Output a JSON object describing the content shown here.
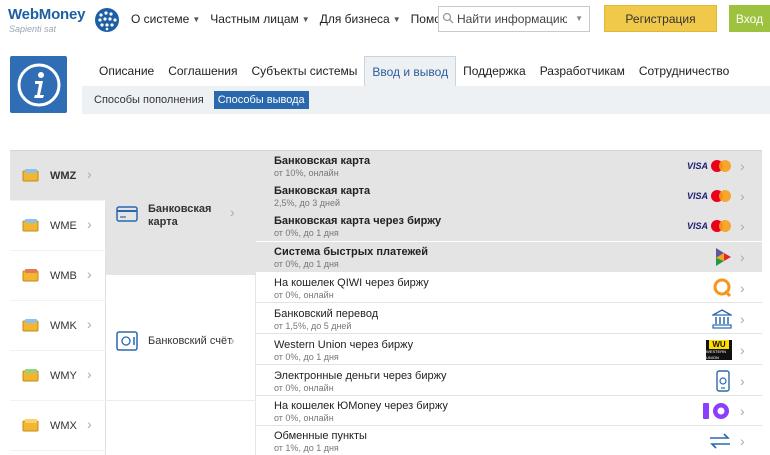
{
  "header": {
    "logo_text": "WebMoney",
    "logo_sub": "Sapienti sat",
    "nav": [
      {
        "label": "О системе"
      },
      {
        "label": "Частным лицам"
      },
      {
        "label": "Для бизнеса"
      },
      {
        "label": "Помощь"
      }
    ],
    "search_placeholder": "Найти информацию",
    "register_label": "Регистрация",
    "login_label": "Вход"
  },
  "tabs": [
    {
      "label": "Описание"
    },
    {
      "label": "Соглашения"
    },
    {
      "label": "Субъекты системы"
    },
    {
      "label": "Ввод и вывод"
    },
    {
      "label": "Поддержка"
    },
    {
      "label": "Разработчикам"
    },
    {
      "label": "Сотрудничество"
    }
  ],
  "active_tab": "Ввод и вывод",
  "subtabs": [
    {
      "label": "Способы пополнения"
    },
    {
      "label": "Способы вывода"
    }
  ],
  "active_subtab": "Способы вывода",
  "currencies": [
    {
      "label": "WMZ",
      "color": "#f2b632"
    },
    {
      "label": "WME",
      "color": "#f2b632"
    },
    {
      "label": "WMB",
      "color": "#f2b632"
    },
    {
      "label": "WMK",
      "color": "#f2b632"
    },
    {
      "label": "WMY",
      "color": "#f2b632"
    },
    {
      "label": "WMX",
      "color": "#f2b632"
    }
  ],
  "active_currency": "WMZ",
  "methods": [
    {
      "label": "Банковская карта"
    },
    {
      "label": "Банковский счёт"
    }
  ],
  "active_method": "Банковская карта",
  "options": [
    {
      "name": "Банковская карта",
      "meta": "от 10%, онлайн",
      "logo": "visa-mastercard-icon"
    },
    {
      "name": "Банковская карта",
      "meta": "2,5%, до 3 дней",
      "logo": "visa-mastercard-icon"
    },
    {
      "name": "Банковская карта через биржу",
      "meta": "от 0%, до 1 дня",
      "logo": "visa-mastercard-icon"
    },
    {
      "name": "Система быстрых платежей",
      "meta": "от 0%, до 1 дня",
      "logo": "sbp-icon"
    },
    {
      "name": "На кошелек QIWI через биржу",
      "meta": "от 0%, онлайн",
      "logo": "qiwi-icon"
    },
    {
      "name": "Банковский перевод",
      "meta": "от 1,5%, до 5 дней",
      "logo": "bank-icon"
    },
    {
      "name": "Western Union через биржу",
      "meta": "от 0%, до 1 дня",
      "logo": "western-union-icon"
    },
    {
      "name": "Электронные деньги через биржу",
      "meta": "от 0%, онлайн",
      "logo": "e-money-icon"
    },
    {
      "name": "На кошелек ЮMoney через биржу",
      "meta": "от 0%, онлайн",
      "logo": "yoomoney-icon"
    },
    {
      "name": "Обменные пункты",
      "meta": "от 1%, до 1 дня",
      "logo": "exchange-icon"
    }
  ],
  "visa_text": "VISA",
  "wu_text": "WESTERN UNION",
  "wu_mark": "WU",
  "colors": {
    "accent": "#2a68ae",
    "register": "#f0c94a",
    "login": "#9cc23f",
    "highlight": "#e4e4e4"
  }
}
